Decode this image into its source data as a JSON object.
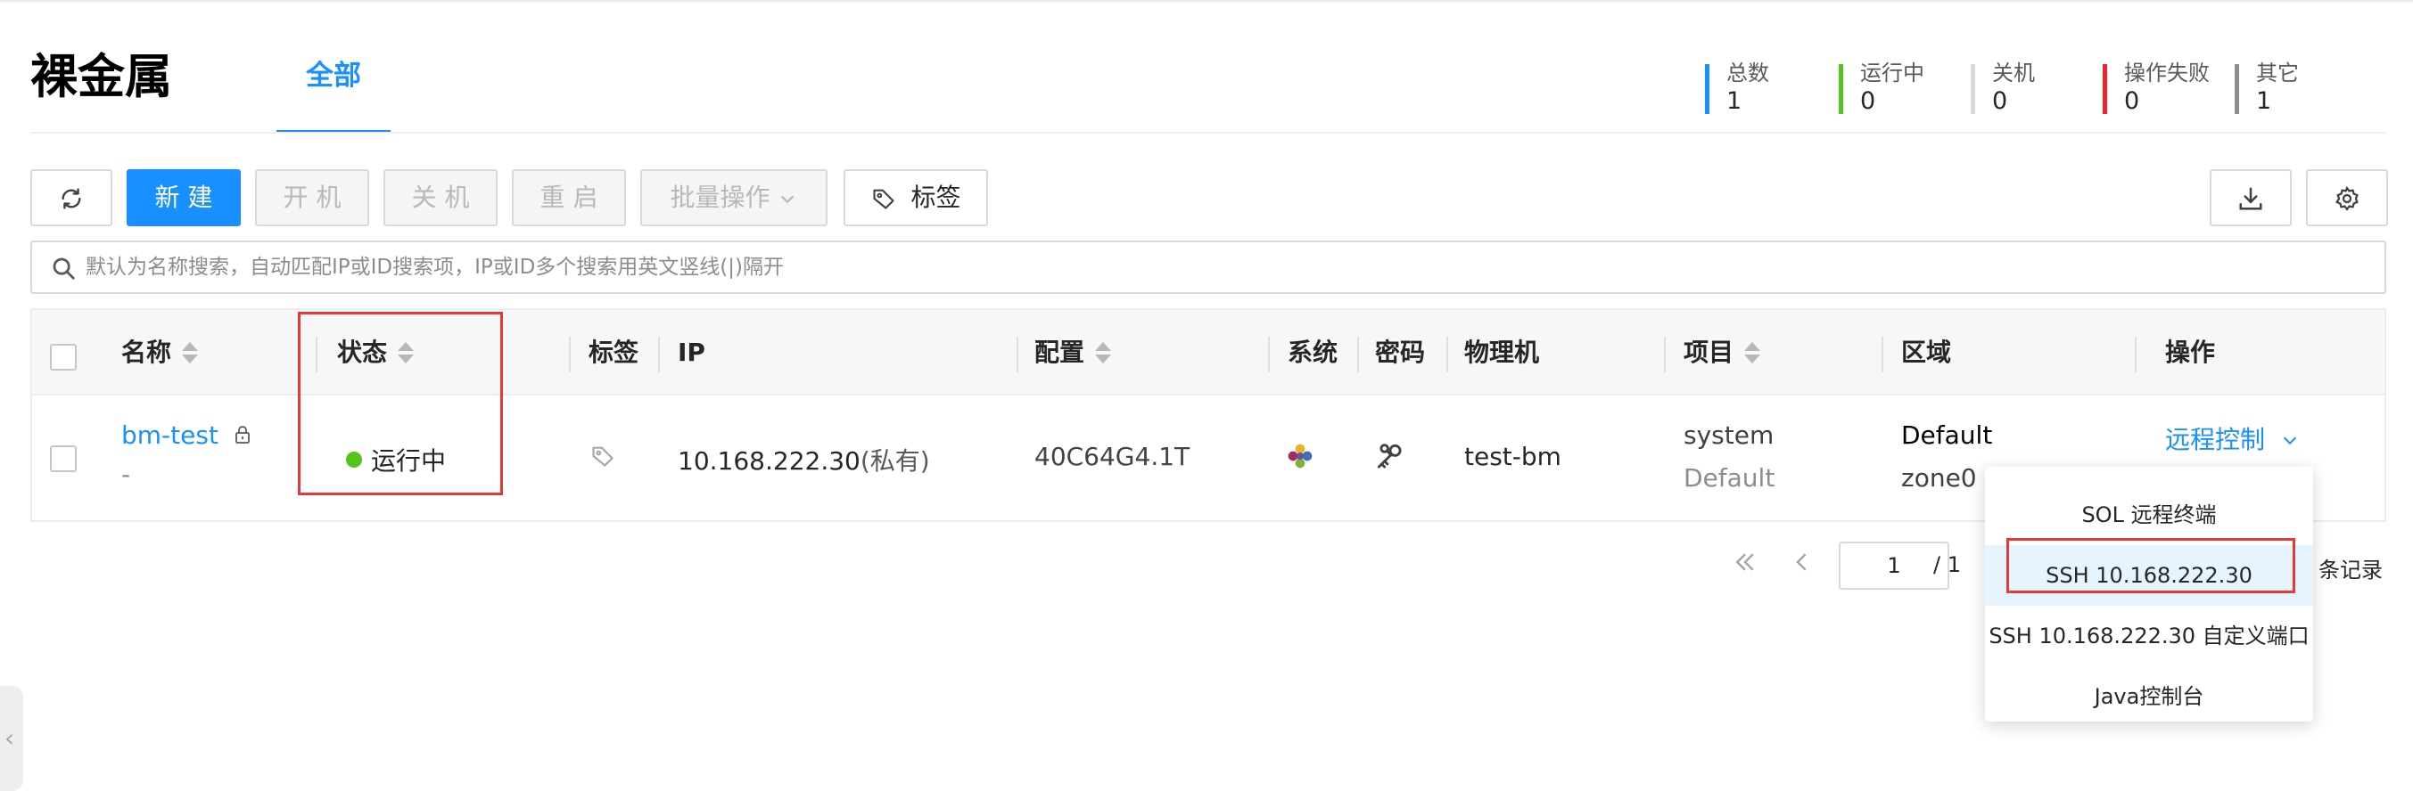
{
  "header": {
    "title": "裸金属",
    "tab_all": "全部"
  },
  "stats": [
    {
      "label": "总数",
      "value": "1",
      "color": "#1890ff"
    },
    {
      "label": "运行中",
      "value": "0",
      "color": "#52c41a"
    },
    {
      "label": "关机",
      "value": "0",
      "color": "#d9d9d9"
    },
    {
      "label": "操作失败",
      "value": "0",
      "color": "#f5222d"
    },
    {
      "label": "其它",
      "value": "1",
      "color": "#8c8c8c"
    }
  ],
  "toolbar": {
    "refresh_icon": "refresh-icon",
    "create": "新 建",
    "power_on": "开 机",
    "power_off": "关 机",
    "restart": "重 启",
    "batch": "批量操作",
    "tags": "标签",
    "download_icon": "download-icon",
    "settings_icon": "gear-icon"
  },
  "search": {
    "placeholder": "默认为名称搜索，自动匹配IP或ID搜索项，IP或ID多个搜索用英文竖线(|)隔开"
  },
  "table": {
    "columns": [
      "名称",
      "状态",
      "标签",
      "IP",
      "配置",
      "系统",
      "密码",
      "物理机",
      "项目",
      "区域",
      "操作"
    ],
    "rows": [
      {
        "name": "bm-test",
        "name_sub": "-",
        "status": "运行中",
        "ip": "10.168.222.30",
        "ip_suffix": "(私有)",
        "config": "40C64G4.1T",
        "system_icon": "os-logo-icon",
        "password_icon": "keys-icon",
        "host": "test-bm",
        "project": "system",
        "project_sub": "Default",
        "region": "Default",
        "region_sub": "zone0",
        "action": "远程控制"
      }
    ]
  },
  "pagination": {
    "page": "1",
    "total_pages": "/ 1",
    "records_suffix": "条记录"
  },
  "remote_menu": {
    "items": [
      "SOL 远程终端",
      "SSH 10.168.222.30",
      "SSH 10.168.222.30 自定义端口",
      "Java控制台"
    ]
  }
}
